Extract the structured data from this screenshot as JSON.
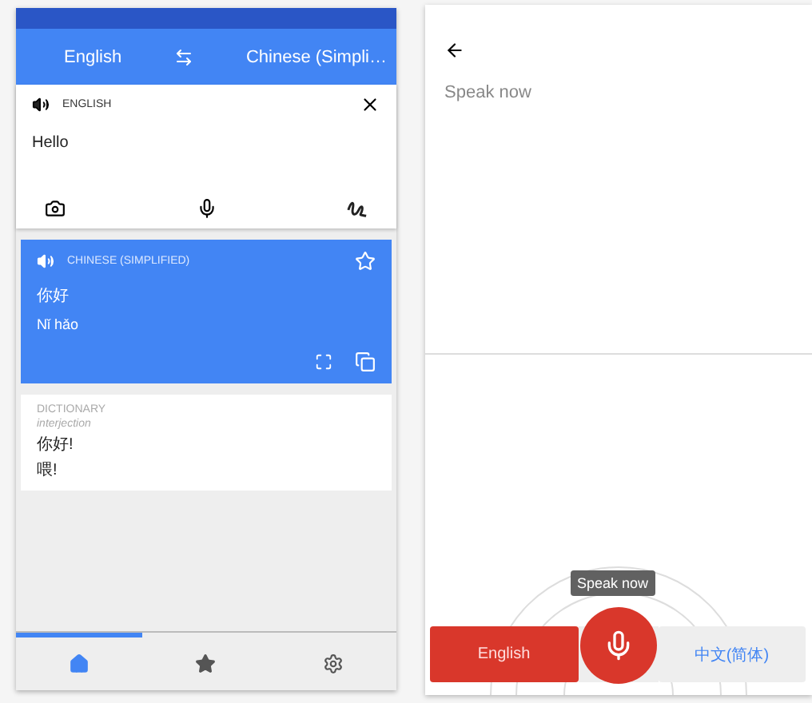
{
  "translate": {
    "source_language": "English",
    "target_language": "Chinese (Simpli…",
    "input": {
      "language_label": "ENGLISH",
      "text": "Hello"
    },
    "result": {
      "language_label": "CHINESE (SIMPLIFIED)",
      "text": "你好",
      "romanization": "Nǐ hǎo",
      "starred": false
    },
    "dictionary": {
      "title": "DICTIONARY",
      "part_of_speech": "interjection",
      "entries": [
        "你好!",
        "喂!"
      ]
    },
    "nav": [
      {
        "kind": "home",
        "selected": true
      },
      {
        "kind": "star",
        "selected": false
      },
      {
        "kind": "settings",
        "selected": false
      }
    ]
  },
  "voice": {
    "prompt": "Speak now",
    "tooltip": "Speak now",
    "languages": [
      {
        "label": "English",
        "selected": true
      },
      {
        "label": "中文(简体)",
        "selected": false
      }
    ]
  }
}
